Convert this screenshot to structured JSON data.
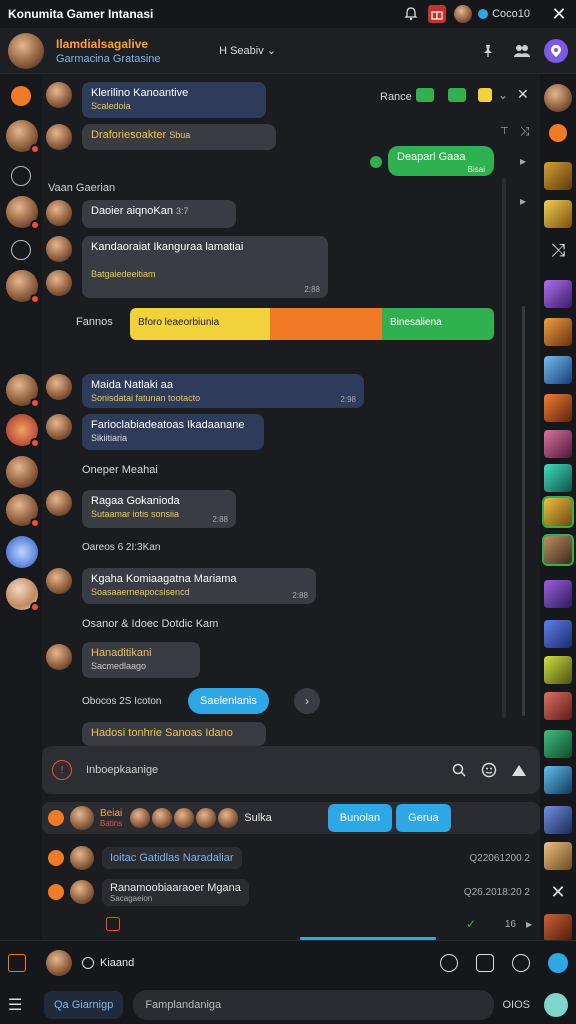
{
  "topbar": {
    "title": "Konumita Gamer Intanasi",
    "status_text": "Coco10"
  },
  "header": {
    "title": "Ilamdialsagalive",
    "subtitle": "Garmacina Gratasine",
    "middle_text": "H Seabiv"
  },
  "chat": {
    "messages": [
      {
        "text": "Klerilino Kanoantive",
        "sub": "Scaledoia"
      },
      {
        "text": "Draforiesoakter",
        "sub": "Sbua"
      },
      {
        "text": "Daoier aiqnoKan",
        "sub": "3:7"
      },
      {
        "text": "Kandaoraiat Ikanguraa lamatiai",
        "sub": "Batgaiedeeitiam",
        "time": "2:88"
      },
      {
        "text": "Maida Natlaki aa",
        "sub": "Sonisdatai fatunan tootacto",
        "time": "2:98"
      },
      {
        "text": "Farioclabiadeatoas Ikadaanane",
        "sub": "Sikiitiaria"
      },
      {
        "text": "Ragaa Gokanioda",
        "sub": "Sutaamar iotis sonsiia",
        "time": "2:88"
      },
      {
        "text": "Kgaha Komiaagatna Mariama",
        "sub": "Soasaaerneapocsisencd",
        "time": "2:88"
      },
      {
        "text": "Hanaditikani",
        "sub": "Sacmedlaago"
      },
      {
        "text": "Hadosi tonhrie Sanoas Idano",
        "sub": ""
      }
    ],
    "system_lines": {
      "voice_label": "Vaan Gaerian",
      "fannos": "Fannos",
      "oneper": "Oneper Meahai",
      "oareos": "Oareos 6 2I:3Kan",
      "osanor": "Osanor & Idoec Dotdic Kam",
      "obocos": "Obocos 2S Icoton"
    },
    "outgoing": {
      "text": "Deaparl Gaaa",
      "time": "Bisai"
    },
    "top_controls": {
      "label": "Rance"
    },
    "banner": {
      "left": "Bforo leaeorbiunia",
      "right": "Binesaliena"
    },
    "button_label": "Saelenlanis"
  },
  "composer": {
    "placeholder": "Inboepkaanige"
  },
  "thread": {
    "row1": {
      "text": "Beiai",
      "sub": "Batins",
      "right_label": "Sulka",
      "btn1": "Bunolan",
      "btn2": "Gerua"
    },
    "row2": {
      "text": "Ioitac Gatidlas Naradaliar",
      "time": "Q22061200 2"
    },
    "row3": {
      "text": "Ranamoobiaaraoer Mgana",
      "time": "Q26.2018:20 2",
      "sub": "Sacagaeion"
    },
    "row4": {
      "time": "16"
    }
  },
  "bottom": {
    "row1_label": "Kiaand",
    "chip": "Qa Giarnigp",
    "input_placeholder": "Famplandaniga",
    "right_text": "OIOS"
  },
  "icons": {
    "notification": "bell-icon",
    "gift": "gift-icon",
    "close": "close-icon",
    "pin": "pin-icon",
    "people": "people-icon",
    "location": "location-icon",
    "search": "search-icon",
    "emoji": "emoji-icon",
    "send": "send-icon"
  },
  "colors": {
    "accent_orange": "#f7a33b",
    "accent_green": "#2fb14f",
    "accent_blue": "#2ea7e6",
    "accent_purple": "#7c5ae8",
    "banner_yellow": "#f2d23a",
    "banner_orange": "#f07a25"
  }
}
